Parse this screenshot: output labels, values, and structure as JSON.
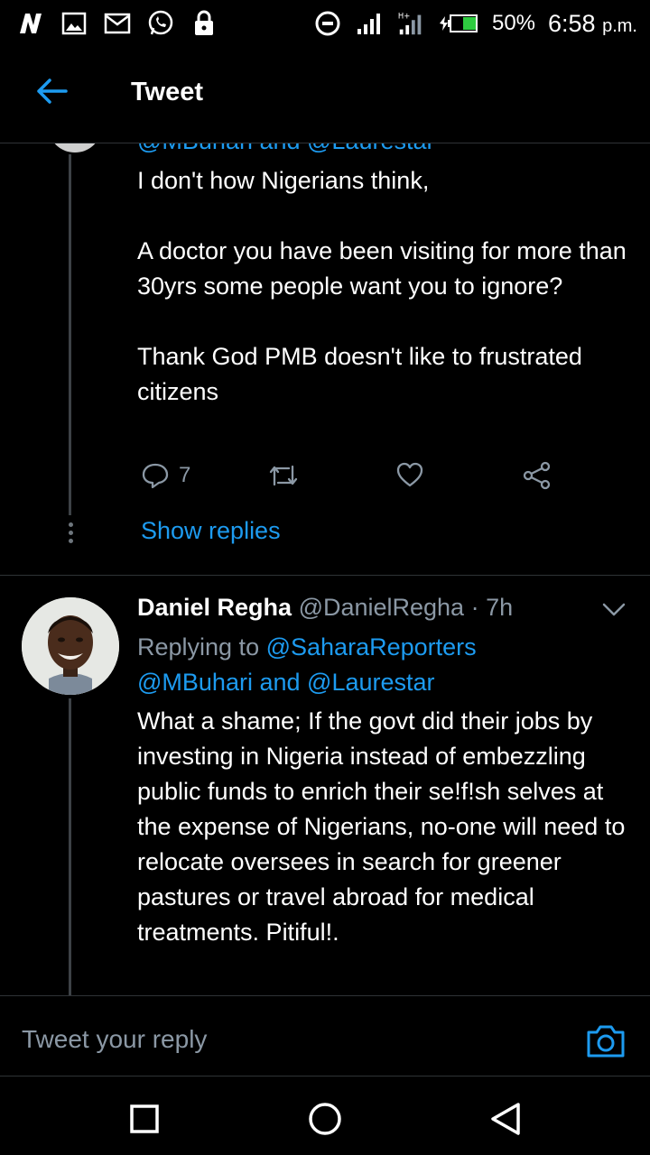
{
  "status_bar": {
    "left_icons": [
      "n-icon",
      "image-icon",
      "mail-icon",
      "whatsapp-icon",
      "lock-icon"
    ],
    "battery": "50%",
    "time": "6:58",
    "time_suffix": "p.m."
  },
  "header": {
    "title": "Tweet"
  },
  "tweet1": {
    "clipped_mentions": "@MBuhari and @Laurestar",
    "text": "I don't how Nigerians think,\n\nA doctor you have been visiting for more than 30yrs some people want you to ignore?\n\nThank God PMB doesn't like to frustrated citizens",
    "reply_count": "7",
    "show_replies": "Show replies"
  },
  "tweet2": {
    "name": "Daniel Regha",
    "handle": "@DanielRegha",
    "separator": "·",
    "time": "7h",
    "replying_prefix": "Replying to",
    "replying_mention1": "@SaharaReporters",
    "replying_mention2": "@MBuhari",
    "replying_and": "and",
    "replying_mention3": "@Laurestar",
    "text": "What a shame; If the govt did their jobs by investing in Nigeria instead of embezzling public funds to enrich their se!f!sh selves at the expense of Nigerians, no-one will need to relocate oversees in search for greener pastures or travel abroad for medical treatments. Pitiful!."
  },
  "reply_bar": {
    "placeholder": "Tweet your reply"
  },
  "colors": {
    "accent": "#1d9bf0",
    "muted": "#8b98a5",
    "background": "#000000",
    "divider": "#2f3336",
    "battery_fill": "#2ecc40"
  }
}
